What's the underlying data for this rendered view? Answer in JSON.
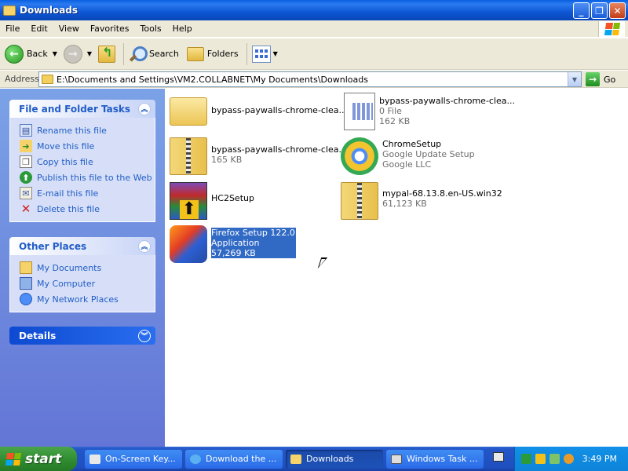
{
  "window": {
    "title": "Downloads"
  },
  "menu": [
    "File",
    "Edit",
    "View",
    "Favorites",
    "Tools",
    "Help"
  ],
  "toolbar": {
    "back_label": "Back",
    "search_label": "Search",
    "folders_label": "Folders"
  },
  "address": {
    "label": "Address",
    "path": "E:\\Documents and Settings\\VM2.COLLABNET\\My Documents\\Downloads",
    "go_label": "Go"
  },
  "tasks_panel": {
    "title": "File and Folder Tasks",
    "items": [
      {
        "label": "Rename this file",
        "icon": "rename-icon"
      },
      {
        "label": "Move this file",
        "icon": "move-icon"
      },
      {
        "label": "Copy this file",
        "icon": "copy-icon"
      },
      {
        "label": "Publish this file to the Web",
        "icon": "publish-web-icon"
      },
      {
        "label": "E-mail this file",
        "icon": "email-icon"
      },
      {
        "label": "Delete this file",
        "icon": "delete-icon"
      }
    ]
  },
  "places_panel": {
    "title": "Other Places",
    "items": [
      {
        "label": "My Documents",
        "icon": "my-documents-icon"
      },
      {
        "label": "My Computer",
        "icon": "my-computer-icon"
      },
      {
        "label": "My Network Places",
        "icon": "network-places-icon"
      }
    ]
  },
  "details_panel": {
    "title": "Details"
  },
  "files": [
    {
      "name": "bypass-paywalls-chrome-clea...",
      "line2": "",
      "line3": "",
      "icon": "folder-icon"
    },
    {
      "name": "bypass-paywalls-chrome-clea...",
      "line2": "0 File",
      "line3": "162 KB",
      "icon": "file-icon"
    },
    {
      "name": "bypass-paywalls-chrome-clea...",
      "line2": "165 KB",
      "line3": "",
      "icon": "zip-folder-icon"
    },
    {
      "name": "ChromeSetup",
      "line2": "Google Update Setup",
      "line3": "Google LLC",
      "icon": "chrome-setup-icon"
    },
    {
      "name": "HC2Setup",
      "line2": "",
      "line3": "",
      "icon": "winrar-icon"
    },
    {
      "name": "mypal-68.13.8.en-US.win32",
      "line2": "61,123 KB",
      "line3": "",
      "icon": "zip-folder-icon"
    },
    {
      "name": "Firefox Setup 122.0",
      "line2": "Application",
      "line3": "57,269 KB",
      "icon": "firefox-setup-icon",
      "selected": true
    }
  ],
  "taskbar": {
    "start_label": "start",
    "buttons": [
      {
        "label": "On-Screen Key...",
        "icon": "keyboard-app-icon"
      },
      {
        "label": "Download the ...",
        "icon": "browser-icon"
      },
      {
        "label": "Downloads",
        "icon": "folder-icon",
        "active": true
      },
      {
        "label": "Windows Task ...",
        "icon": "task-manager-icon"
      }
    ],
    "clock": "3:49 PM"
  }
}
